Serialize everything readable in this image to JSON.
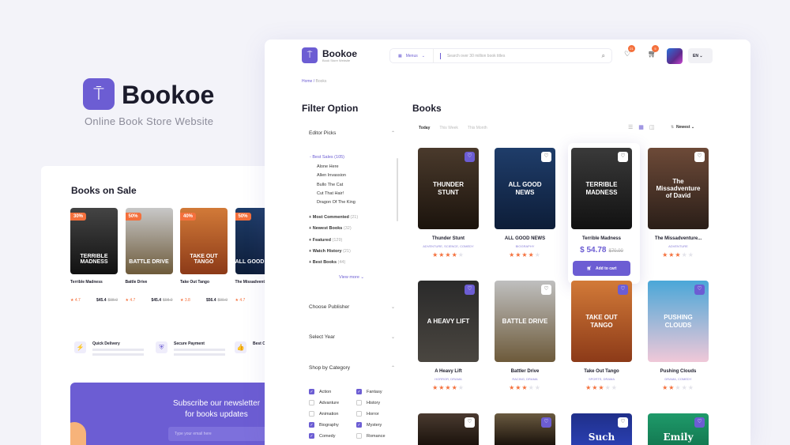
{
  "brand": {
    "name": "Bookoe",
    "tagline": "Online Book Store Website"
  },
  "sale": {
    "title": "Books on Sale",
    "books": [
      {
        "discount": "30%",
        "cover": "TERRIBLE MADNESS",
        "title": "Terrible Madness",
        "rating": "4.7",
        "price": "$45.4",
        "old": "$98.0"
      },
      {
        "discount": "50%",
        "cover": "BATTLE DRIVE",
        "title": "Battle Drive",
        "rating": "4.7",
        "price": "$45.4",
        "old": "$98.0"
      },
      {
        "discount": "40%",
        "cover": "TAKE OUT TANGO",
        "title": "Take Out Tango",
        "rating": "3.8",
        "price": "$56.4",
        "old": "$90.0"
      },
      {
        "discount": "50%",
        "cover": "ALL GOOD NEWS",
        "title": "The Missadventure",
        "rating": "4.7",
        "price": "",
        "old": ""
      }
    ],
    "features": [
      "Quick Delivery",
      "Secure Payment",
      "Best Or"
    ],
    "newsletter": {
      "title": "Subscribe our newsletter for books updates",
      "placeholder": "Type your email here"
    }
  },
  "header": {
    "name": "Bookoe",
    "sub": "Book Store Website",
    "menus": "Menus",
    "search_placeholder": "Search over 30 million book titles",
    "wishlist_count": "21",
    "cart_count": "5",
    "lang": "EN"
  },
  "breadcrumb": [
    "Home /",
    "Books"
  ],
  "filter": {
    "title": "Filter Option",
    "editor_picks": "Editor Picks",
    "best_sales": "- Best Sales (105)",
    "best_items": [
      "Alone Here",
      "Allen Invassion",
      "Bullo The Cat",
      "Cut That Hair!",
      "Dragon Of The King"
    ],
    "groups": [
      {
        "label": "+ Most Commented",
        "count": "(21)"
      },
      {
        "label": "+ Newest Books",
        "count": "(32)"
      },
      {
        "label": "+ Featured",
        "count": "(129)"
      },
      {
        "label": "+ Watch History",
        "count": "(21)"
      },
      {
        "label": "+ Best Books",
        "count": "(44)"
      }
    ],
    "view_more": "View more ⌄",
    "publisher": "Choose Publisher",
    "year": "Select Year",
    "category": "Shop by Category",
    "categories": [
      {
        "label": "Action",
        "checked": true
      },
      {
        "label": "Fantasy",
        "checked": true
      },
      {
        "label": "Advanture",
        "checked": false
      },
      {
        "label": "History",
        "checked": false
      },
      {
        "label": "Animation",
        "checked": false
      },
      {
        "label": "Horror",
        "checked": false
      },
      {
        "label": "Biography",
        "checked": true
      },
      {
        "label": "Mystery",
        "checked": true
      },
      {
        "label": "Comedy",
        "checked": true
      },
      {
        "label": "Romance",
        "checked": false
      }
    ]
  },
  "books": {
    "title": "Books",
    "tabs": [
      "Today",
      "This Week",
      "This Month"
    ],
    "sort": "Newest",
    "hover": {
      "price": "$ 54.78",
      "old": "$70.00",
      "cart": "Add to cart"
    },
    "items": [
      {
        "cover": "THUNDER STUNT",
        "title": "Thunder Stunt",
        "genre": "Adventure, Science, Comedy",
        "stars": 4,
        "fav": true
      },
      {
        "cover": "ALL GOOD NEWS",
        "title": "ALL GOOD NEWS",
        "genre": "Biography",
        "stars": 4,
        "fav": false
      },
      {
        "cover": "TERRIBLE MADNESS",
        "title": "Terrible Madness",
        "genre": "",
        "stars": 0,
        "fav": false
      },
      {
        "cover": "The Missadventure of David",
        "title": "The Missadventure...",
        "genre": "Adventure",
        "stars": 3,
        "fav": false
      },
      {
        "cover": "A HEAVY LIFT",
        "title": "A Heavy Lift",
        "genre": "Horror, Drama",
        "stars": 4,
        "fav": true
      },
      {
        "cover": "BATTLE DRIVE",
        "title": "Battler Drive",
        "genre": "Racing, Drama",
        "stars": 3,
        "fav": false
      },
      {
        "cover": "TAKE OUT TANGO",
        "title": "Take Out Tango",
        "genre": "Sports, Drama",
        "stars": 3,
        "fav": true
      },
      {
        "cover": "PUSHING CLOUDS",
        "title": "Pushing Clouds",
        "genre": "Drama, Comedy",
        "stars": 2,
        "fav": true
      },
      {
        "cover": "",
        "title": "",
        "genre": "",
        "stars": 0,
        "fav": false
      },
      {
        "cover": "",
        "title": "",
        "genre": "",
        "stars": 0,
        "fav": true
      },
      {
        "cover": "Such",
        "title": "",
        "genre": "",
        "stars": 0,
        "fav": false
      },
      {
        "cover": "Emily",
        "title": "",
        "genre": "",
        "stars": 0,
        "fav": true
      }
    ]
  },
  "colors": {
    "accent": "#6c5dd3",
    "orange": "#f4703c"
  }
}
